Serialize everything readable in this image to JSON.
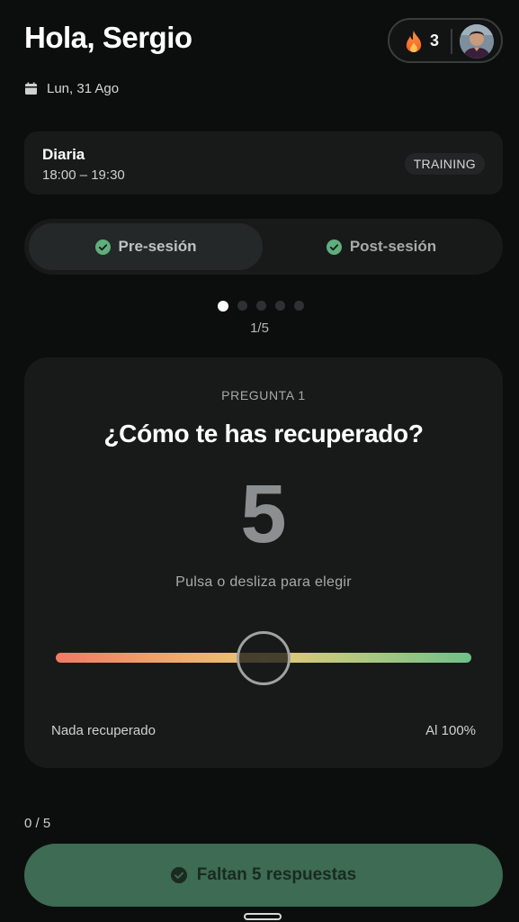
{
  "header": {
    "greeting": "Hola, Sergio",
    "streak_count": "3",
    "date": "Lun, 31 Ago"
  },
  "session": {
    "title": "Diaria",
    "time": "18:00 – 19:30",
    "badge": "TRAINING"
  },
  "segments": {
    "pre_label": "Pre-sesión",
    "post_label": "Post-sesión",
    "active": "pre"
  },
  "pager": {
    "current": 1,
    "total": 5,
    "label": "1/5"
  },
  "question": {
    "number_label": "PREGUNTA 1",
    "title": "¿Cómo te has recuperado?",
    "value": "5",
    "hint": "Pulsa o desliza para elegir",
    "scale_min_label": "Nada recuperado",
    "scale_max_label": "Al 100%",
    "slider_fraction": 0.5
  },
  "footer": {
    "progress": "0 / 5",
    "cta_label": "Faltan 5 respuestas"
  },
  "colors": {
    "accent_green": "#3d6b53",
    "check_green": "#5fae7c",
    "gradient_start": "#f07a63",
    "gradient_end": "#6fc08a"
  },
  "icons": {
    "date": "calendar-icon",
    "streak": "flame-icon",
    "check": "check-circle-icon"
  }
}
